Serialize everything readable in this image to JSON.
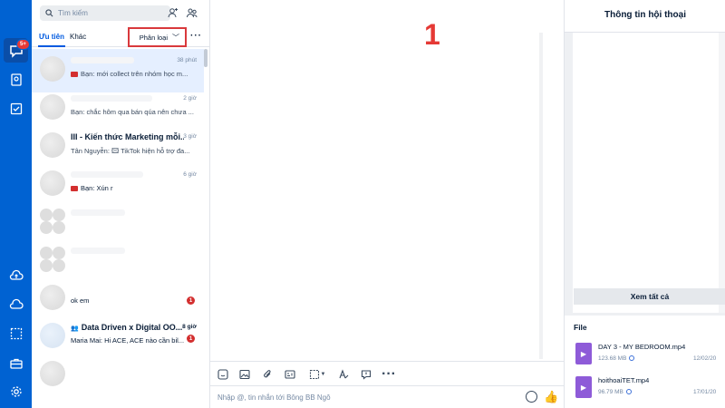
{
  "rail": {
    "messages_badge": "5+",
    "top_icons": [
      "chat-icon",
      "contacts-icon",
      "todo-icon"
    ],
    "bottom_icons": [
      "cloud-upload-icon",
      "cloud-icon",
      "screenshot-icon",
      "briefcase-icon",
      "settings-icon"
    ]
  },
  "list": {
    "search_placeholder": "Tìm kiếm",
    "tabs": [
      "Ưu tiên",
      "Khác"
    ],
    "classify_label": "Phân loại",
    "conversations": [
      {
        "title": "",
        "time": "38 phút",
        "preview": "Bạn: mới collect trên nhóm học m..."
      },
      {
        "title": "",
        "time": "2 giờ",
        "preview": "Bạn: chắc hôm qua bán qúa nên chưa ..."
      },
      {
        "title": "III - Kiến thức Marketing mỗi...",
        "time": "3 giờ",
        "preview": "Tân Nguyễn: 🖾 TikTok hiện hỗ trợ đa..."
      },
      {
        "title": "",
        "time": "6 giờ",
        "preview": "Bạn: Xún r"
      },
      {
        "title": "",
        "time": "",
        "preview": ""
      },
      {
        "title": "",
        "time": "",
        "preview": ""
      },
      {
        "title": "",
        "time": "",
        "preview": "ok em",
        "unread": "1"
      },
      {
        "title": "Data Driven x Digital OO...",
        "time": "8 giờ",
        "preview": "Maria Mai: Hi ACE, ACE nào cần bil...",
        "unread": "1"
      },
      {
        "title": "",
        "time": "",
        "preview": ""
      }
    ]
  },
  "annotation": {
    "marker": "1"
  },
  "chat": {
    "compose_placeholder": "Nhập @, tin nhắn tới Bông BB Ngô"
  },
  "info": {
    "title": "Thông tin hội thoại",
    "see_all": "Xem tất cả",
    "file_heading": "File",
    "files": [
      {
        "name": "DAY 3 -  MY BEDROOM.mp4",
        "size": "123.68 MB",
        "date": "12/02/20"
      },
      {
        "name": "hoithoaiTET.mp4",
        "size": "96.79 MB",
        "date": "17/01/20"
      }
    ]
  },
  "colors": {
    "rail": "#0062d2",
    "accent": "#005ae0",
    "highlight_box": "#d9393c",
    "selected_row": "#e5efff"
  }
}
